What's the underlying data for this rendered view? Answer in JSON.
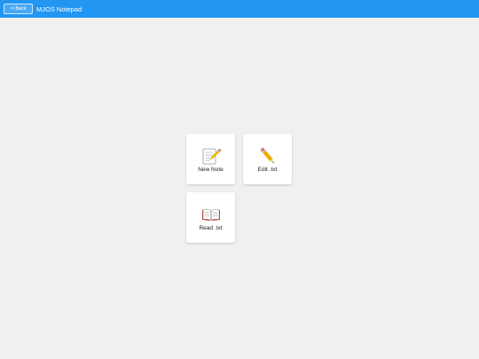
{
  "header": {
    "back_label": "Back",
    "back_icon": "arrow-left-icon",
    "title": "MJOS Notepad",
    "bar_color": "#2196f3"
  },
  "tiles": [
    {
      "label": "New Note",
      "icon": "memo-pencil-icon"
    },
    {
      "label": "Edit .txt",
      "icon": "pencil-icon"
    },
    {
      "label": "Read .txt",
      "icon": "open-book-icon"
    }
  ]
}
